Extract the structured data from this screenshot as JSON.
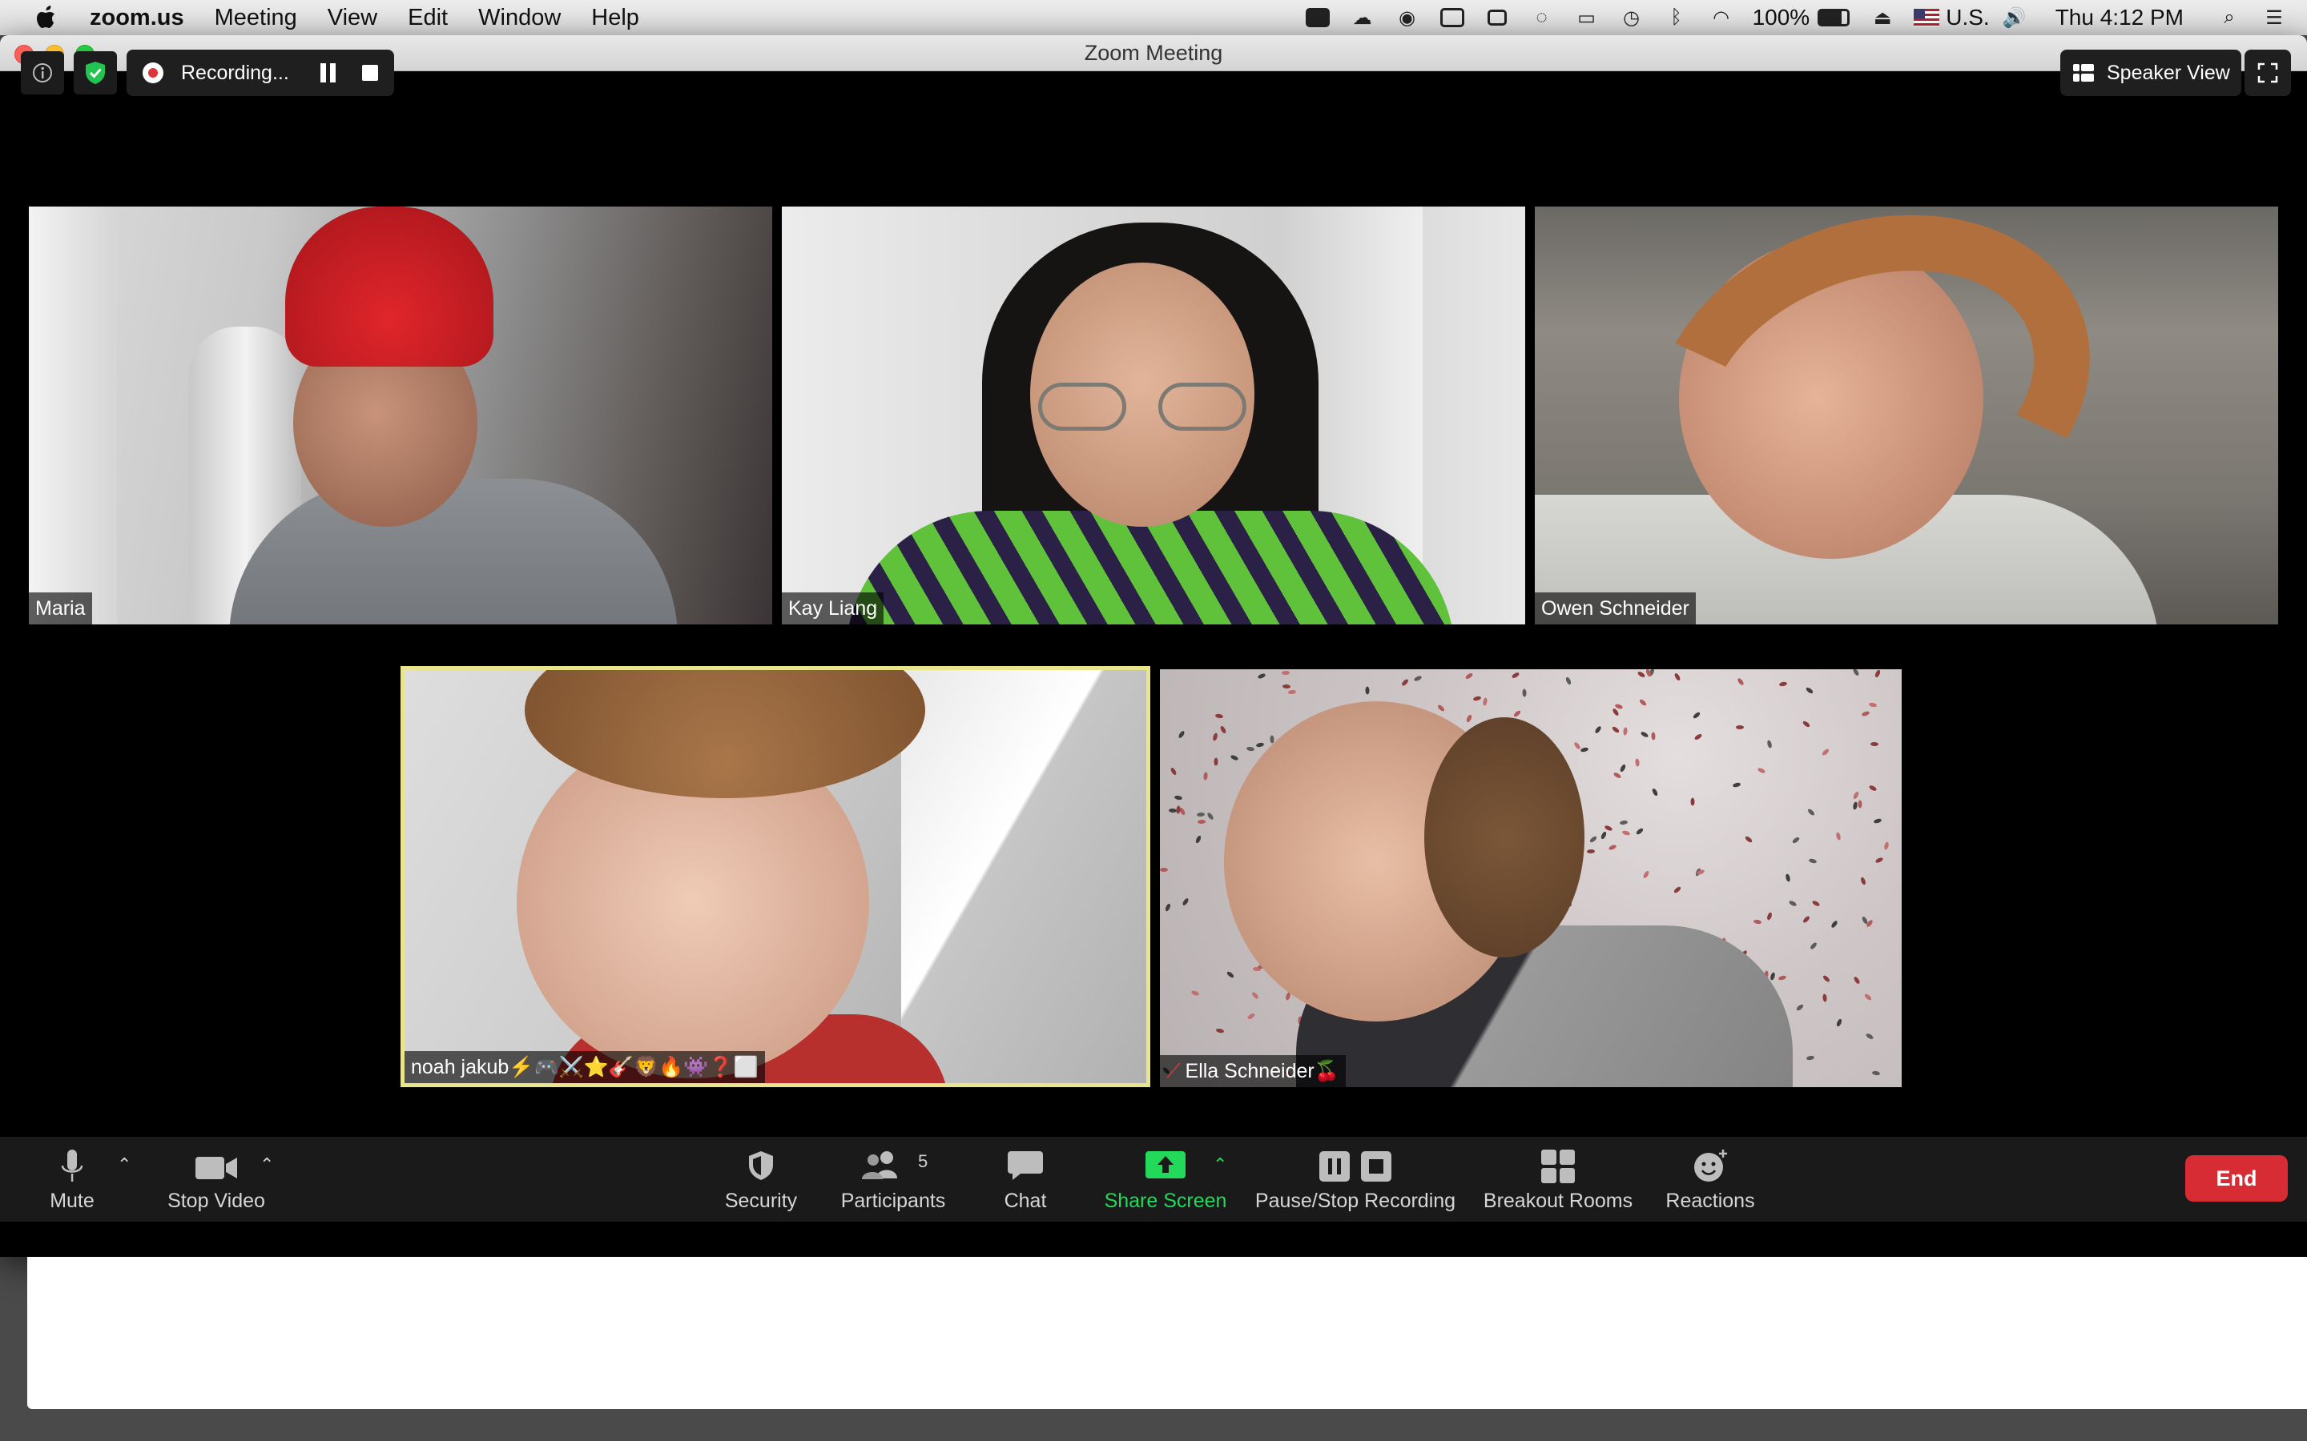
{
  "menubar": {
    "app_name": "zoom.us",
    "items": [
      "Meeting",
      "View",
      "Edit",
      "Window",
      "Help"
    ],
    "battery": "100%",
    "input_source": "U.S.",
    "clock": "Thu 4:12 PM"
  },
  "window": {
    "title": "Zoom Meeting"
  },
  "recording": {
    "label": "Recording..."
  },
  "view": {
    "speaker_view_label": "Speaker View"
  },
  "participants": {
    "tiles": [
      {
        "name": "Maria"
      },
      {
        "name": "Kay Liang"
      },
      {
        "name": "Owen Schneider"
      },
      {
        "name": "noah jakub⚡🎮⚔️⭐🎸🦁🔥👾❓⬜"
      },
      {
        "name": "Ella Schneider🍒"
      }
    ],
    "active_speaker_color": "#e8e58a"
  },
  "toolbar": {
    "mute": "Mute",
    "stop_video": "Stop Video",
    "security": "Security",
    "participants": "Participants",
    "participant_count": "5",
    "chat": "Chat",
    "share_screen": "Share Screen",
    "pause_stop_recording": "Pause/Stop Recording",
    "breakout_rooms": "Breakout Rooms",
    "reactions": "Reactions",
    "end": "End",
    "share_color": "#23d959",
    "end_color": "#d72c33"
  }
}
